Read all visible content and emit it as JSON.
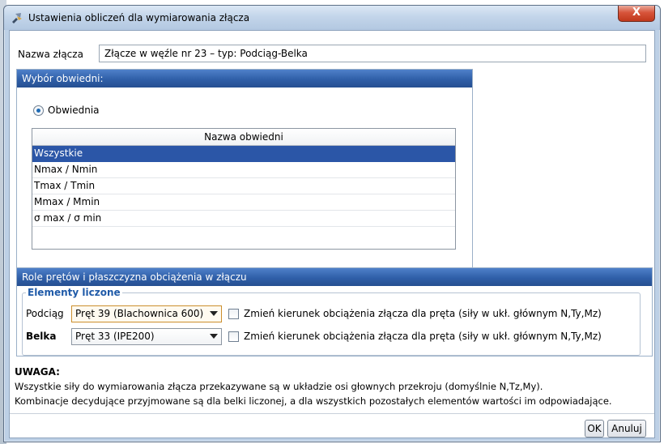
{
  "window": {
    "title": "Ustawienia obliczeń dla wymiarowania złącza",
    "close_label": "X"
  },
  "name_field": {
    "label": "Nazwa złącza",
    "value": "Złącze w węźle nr 23 – typ: Podciąg-Belka"
  },
  "envelope_panel": {
    "header": "Wybór obwiedni:",
    "radio_label": "Obwiednia",
    "table_header": "Nazwa obwiedni",
    "rows": [
      "Wszystkie",
      "Nmax / Nmin",
      "Tmax / Tmin",
      "Mmax / Mmin",
      "σ max / σ min"
    ],
    "selected_row": "Wszystkie"
  },
  "roles_panel": {
    "header": "Role prętów i płaszczyzna obciążenia w złączu",
    "group_legend": "Elementy liczone",
    "rows": [
      {
        "label": "Podciąg",
        "select_value": "Pręt 39 (Blachownica 600)",
        "checkbox_label": "Zmień kierunek obciążenia złącza dla pręta (siły w ukł. głównym N,Ty,Mz)"
      },
      {
        "label": "Belka",
        "select_value": "Pręt 33 (IPE200)",
        "checkbox_label": "Zmień kierunek obciążenia złącza dla pręta (siły w ukł. głównym N,Ty,Mz)"
      }
    ]
  },
  "note": {
    "title": "UWAGA:",
    "line1": "Wszystkie siły do wymiarowania złącza przekazywane są w układzie osi głownych przekroju (domyślnie N,Tz,My).",
    "line2": "Kombinacje decydujące przyjmowane są dla belki liczonej, a dla wszystkich pozostałych elementów wartości im odpowiadające."
  },
  "buttons": {
    "ok": "OK",
    "cancel": "Anuluj"
  }
}
